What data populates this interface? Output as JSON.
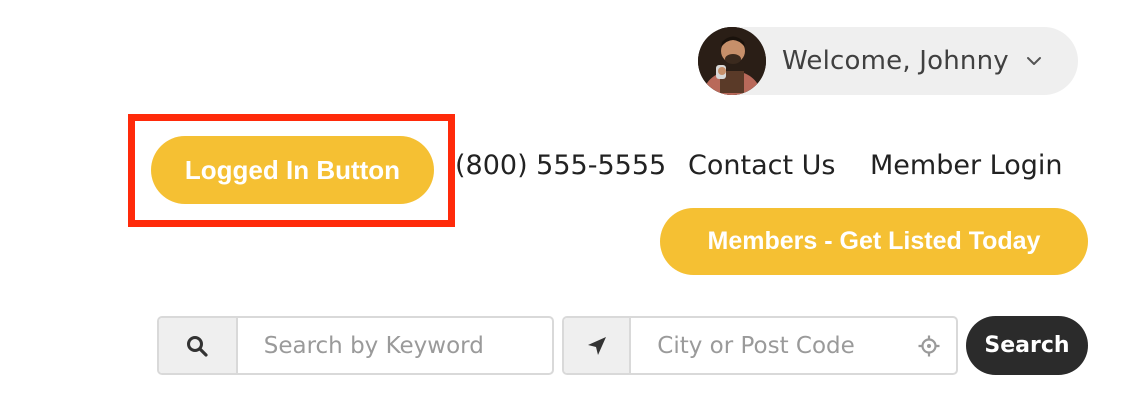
{
  "header": {
    "welcome_text": "Welcome, Johnny",
    "avatar_alt": "Johnny profile photo",
    "logged_in_button": "Logged In Button",
    "phone": "(800) 555-5555",
    "contact_link": "Contact Us",
    "login_link": "Member Login",
    "members_button": "Members - Get Listed Today"
  },
  "search": {
    "keyword_placeholder": "Search by Keyword",
    "location_placeholder": "City or Post Code",
    "button_label": "Search"
  },
  "icons": {
    "chevron": "chevron-down-icon",
    "keyword": "search-icon",
    "location": "location-arrow-icon",
    "locate": "crosshair-icon"
  },
  "colors": {
    "accent": "#f5c033",
    "highlight": "#ff2a0a",
    "search_button": "#2b2b2b",
    "pill_bg": "#efefef"
  }
}
